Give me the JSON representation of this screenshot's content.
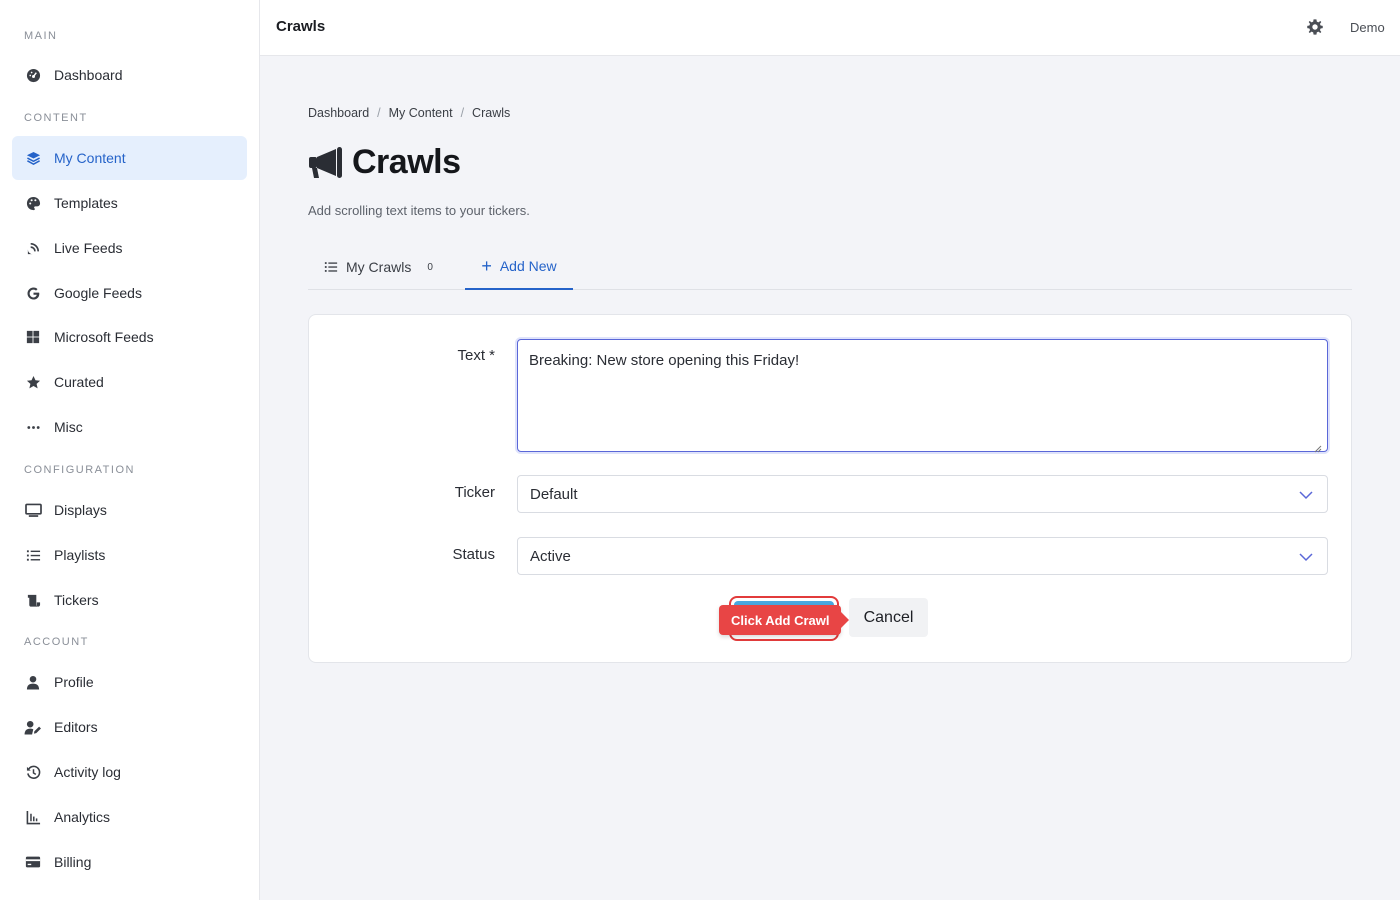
{
  "sidebar": {
    "sections": [
      {
        "label": "MAIN"
      },
      {
        "label": "CONTENT"
      },
      {
        "label": "CONFIGURATION"
      },
      {
        "label": "ACCOUNT"
      }
    ],
    "items": [
      {
        "label": "Dashboard",
        "icon": "dashboard-gauge-icon"
      },
      {
        "label": "My Content",
        "icon": "layers-icon",
        "active": true
      },
      {
        "label": "Templates",
        "icon": "palette-icon"
      },
      {
        "label": "Live Feeds",
        "icon": "satellite-dish-icon"
      },
      {
        "label": "Google Feeds",
        "icon": "google-icon"
      },
      {
        "label": "Microsoft Feeds",
        "icon": "windows-icon"
      },
      {
        "label": "Curated",
        "icon": "star-icon"
      },
      {
        "label": "Misc",
        "icon": "ellipsis-icon"
      },
      {
        "label": "Displays",
        "icon": "monitor-icon"
      },
      {
        "label": "Playlists",
        "icon": "list-icon"
      },
      {
        "label": "Tickers",
        "icon": "scroll-icon"
      },
      {
        "label": "Profile",
        "icon": "user-icon"
      },
      {
        "label": "Editors",
        "icon": "user-edit-icon"
      },
      {
        "label": "Activity log",
        "icon": "history-icon"
      },
      {
        "label": "Analytics",
        "icon": "chart-icon"
      },
      {
        "label": "Billing",
        "icon": "credit-card-icon"
      }
    ]
  },
  "topbar": {
    "title": "Crawls",
    "user": "Demo"
  },
  "breadcrumb": [
    "Dashboard",
    "My Content",
    "Crawls"
  ],
  "page": {
    "title": "Crawls",
    "subtitle": "Add scrolling text items to your tickers."
  },
  "tabs": {
    "my_crawls": {
      "label": "My Crawls",
      "count": "0"
    },
    "add_new": {
      "label": "Add New"
    }
  },
  "form": {
    "text_label": "Text *",
    "text_value": "Breaking: New store opening this Friday!",
    "ticker_label": "Ticker",
    "ticker_value": "Default",
    "status_label": "Status",
    "status_value": "Active",
    "cancel_label": "Cancel",
    "hint_label": "Click Add Crawl"
  },
  "colors": {
    "accent": "#2563c9",
    "active_bg": "#e5effd",
    "hint": "#e84545"
  }
}
